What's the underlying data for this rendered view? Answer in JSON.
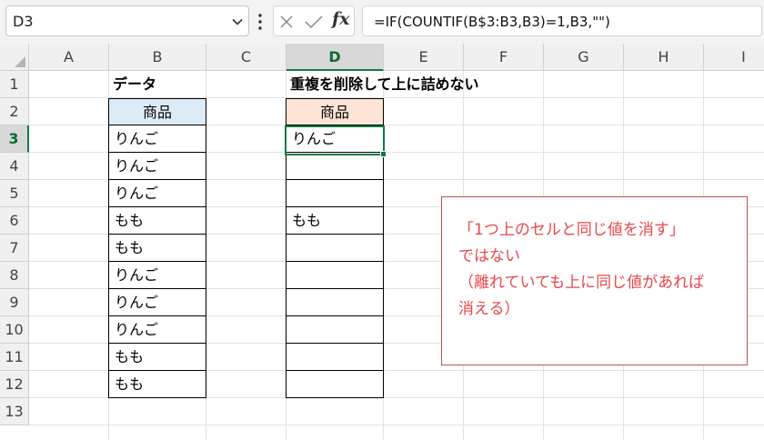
{
  "name_box": {
    "value": "D3"
  },
  "formula_bar": {
    "formula": "=IF(COUNTIF(B$3:B3,B3)=1,B3,\"\")",
    "fx_label": "fx"
  },
  "columns": [
    "A",
    "B",
    "C",
    "D",
    "E",
    "F",
    "G",
    "H",
    "I"
  ],
  "rows": [
    "1",
    "2",
    "3",
    "4",
    "5",
    "6",
    "7",
    "8",
    "9",
    "10",
    "11",
    "12",
    "13"
  ],
  "selected": {
    "column": "D",
    "row": "3"
  },
  "labels": {
    "data_title": "データ",
    "result_title": "重複を削除して上に詰めない"
  },
  "table_b": {
    "header": "商品",
    "values": [
      "りんご",
      "りんご",
      "りんご",
      "もも",
      "もも",
      "りんご",
      "りんご",
      "りんご",
      "もも",
      "もも"
    ]
  },
  "table_d": {
    "header": "商品",
    "values": [
      "りんご",
      "",
      "",
      "もも",
      "",
      "",
      "",
      "",
      "",
      ""
    ]
  },
  "note": {
    "lines": [
      "「1つ上のセルと同じ値を消す」",
      "ではない",
      "（離れていても上に同じ値があれば",
      "消える）"
    ]
  },
  "colors": {
    "accent": "#107c41",
    "header_b": "#ddebf7",
    "header_d": "#fce4d6",
    "note_text": "#e8474b",
    "note_border": "#c0504d"
  }
}
